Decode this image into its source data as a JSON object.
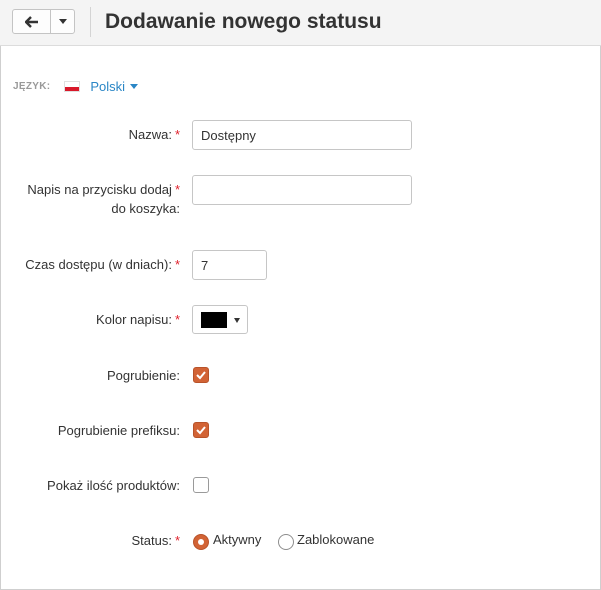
{
  "header": {
    "title": "Dodawanie nowego statusu",
    "back_icon": "arrow-left-icon",
    "more_icon": "caret-down-icon"
  },
  "language": {
    "label": "JĘZYK:",
    "selected": "Polski",
    "flag_icon": "poland-flag-icon"
  },
  "form": {
    "name": {
      "label": "Nazwa:",
      "required": "*",
      "value": "Dostępny"
    },
    "button_text": {
      "label_line1": "Napis na przycisku dodaj",
      "label_line2": "do koszyka:",
      "required": "*",
      "value": ""
    },
    "access_time": {
      "label": "Czas dostępu (w dniach):",
      "required": "*",
      "value": "7"
    },
    "text_color": {
      "label": "Kolor napisu:",
      "required": "*",
      "color": "#000000"
    },
    "bold": {
      "label": "Pogrubienie:",
      "checked": true
    },
    "bold_prefix": {
      "label": "Pogrubienie prefiksu:",
      "checked": true
    },
    "show_count": {
      "label": "Pokaż ilość produktów:",
      "checked": false
    },
    "status": {
      "label": "Status:",
      "required": "*",
      "options": [
        "Aktywny",
        "Zablokowane"
      ],
      "selected": "Aktywny"
    }
  },
  "colors": {
    "accent": "#d26335",
    "link": "#2a86c6",
    "required": "#e0202c"
  }
}
